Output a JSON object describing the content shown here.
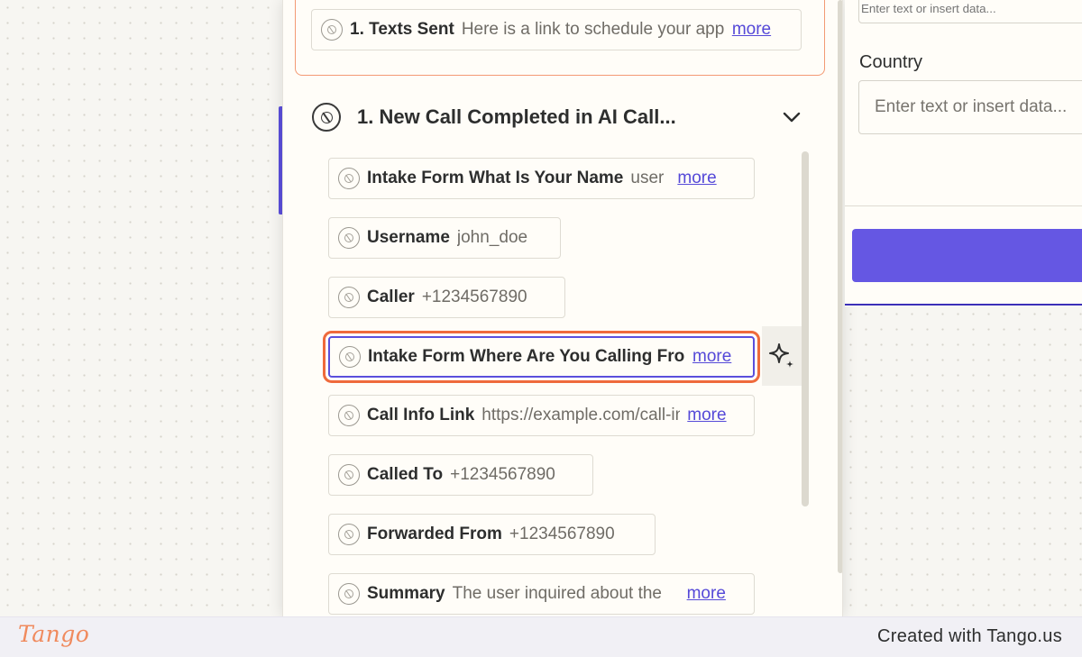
{
  "previous_step": {
    "field": {
      "label": "1. Texts Sent",
      "value": "Here is a link to schedule your appointment",
      "more": "more"
    }
  },
  "group": {
    "title": "1.  New Call Completed in AI Call...",
    "fields": [
      {
        "label": "Intake Form What Is Your Name",
        "value": "user",
        "more": "more"
      },
      {
        "label": "Username",
        "value": "john_doe",
        "more": ""
      },
      {
        "label": "Caller",
        "value": "+1234567890",
        "more": ""
      },
      {
        "label": "Intake Form Where Are You Calling From",
        "value": "",
        "more": "more"
      },
      {
        "label": "Call Info Link",
        "value": "https://example.com/call-info",
        "more": "more"
      },
      {
        "label": "Called To",
        "value": "+1234567890",
        "more": ""
      },
      {
        "label": "Forwarded From",
        "value": "+1234567890",
        "more": ""
      },
      {
        "label": "Summary",
        "value": "The user inquired about the",
        "more": "more"
      }
    ]
  },
  "form": {
    "top_placeholder": "Enter text or insert data...",
    "country_label": "Country",
    "country_placeholder": "Enter text or insert data..."
  },
  "footer": {
    "logo": "Tango",
    "credit": "Created with Tango.us"
  },
  "colors": {
    "accent": "#6557e3",
    "highlight": "#ef6a3c",
    "link": "#5549d8"
  },
  "icons": {
    "field": "app-logo-icon",
    "collapse": "chevron-down-icon",
    "ai": "sparkle-icon"
  }
}
